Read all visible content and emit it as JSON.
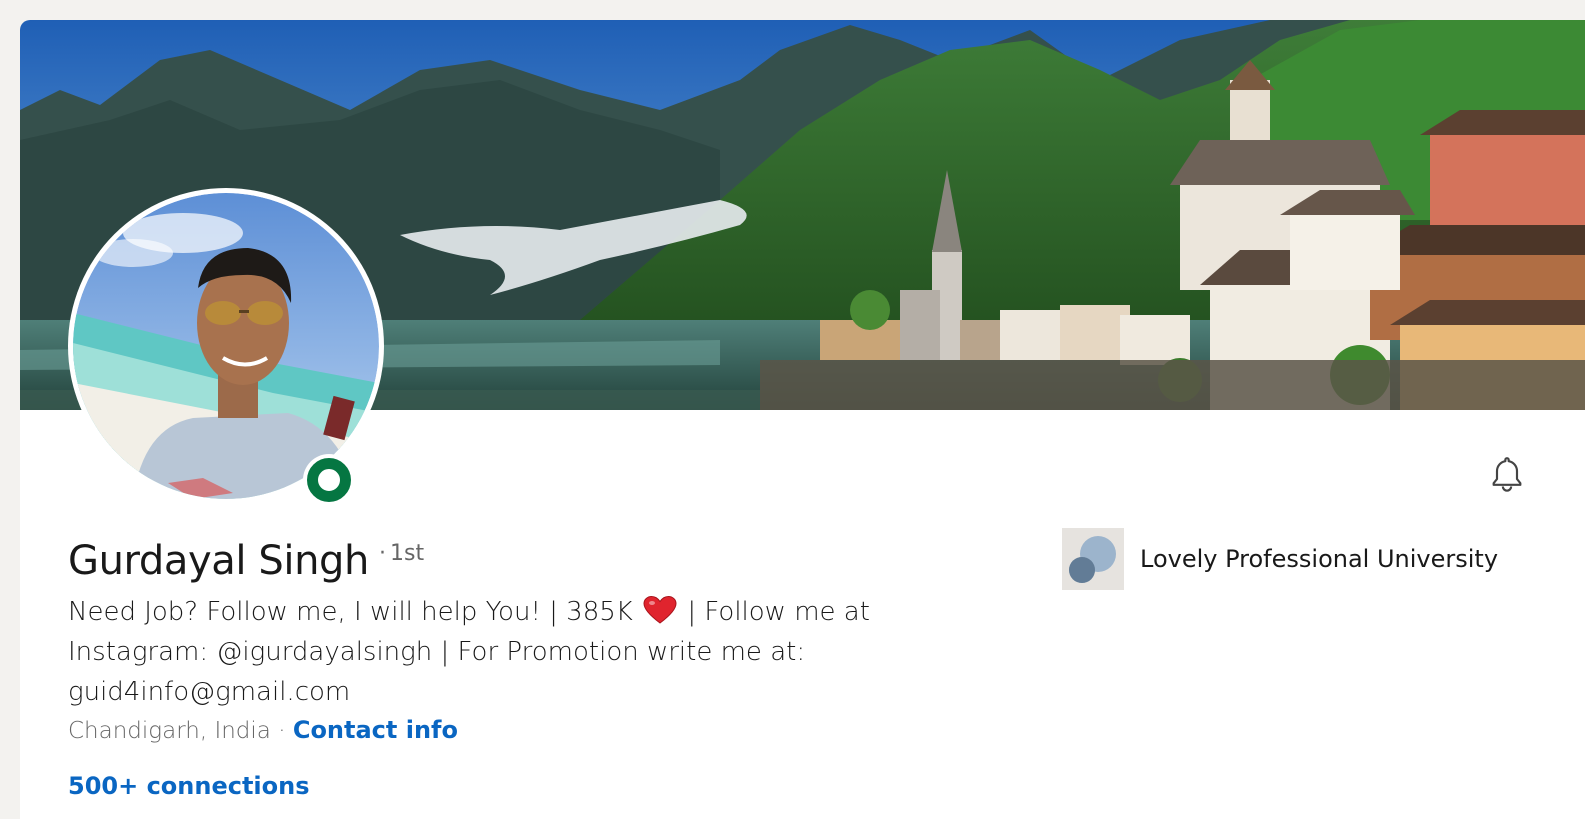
{
  "profile": {
    "name": "Gurdayal Singh",
    "degree_separator": "·",
    "degree": "1st",
    "headline_part1": "Need Job? Follow me, I will help You! | 385K",
    "headline_part2": "| Follow me at Instagram: @igurdayalsingh | For Promotion write me at: guid4info@gmail.com",
    "location": "Chandigarh, India",
    "location_separator": " · ",
    "contact_info_label": "Contact info",
    "connections_label": "500+ connections",
    "status": "online"
  },
  "education": {
    "school_name": "Lovely Professional University"
  },
  "icons": {
    "notification": "bell-icon",
    "heart": "heart-icon",
    "online_status": "online-status-icon",
    "school_logo": "school-logo-icon"
  },
  "colors": {
    "link": "#0a66c2",
    "online": "#057642",
    "text": "#191919",
    "muted": "#666666",
    "background": "#f3f2ef",
    "heart": "#e0242e"
  }
}
